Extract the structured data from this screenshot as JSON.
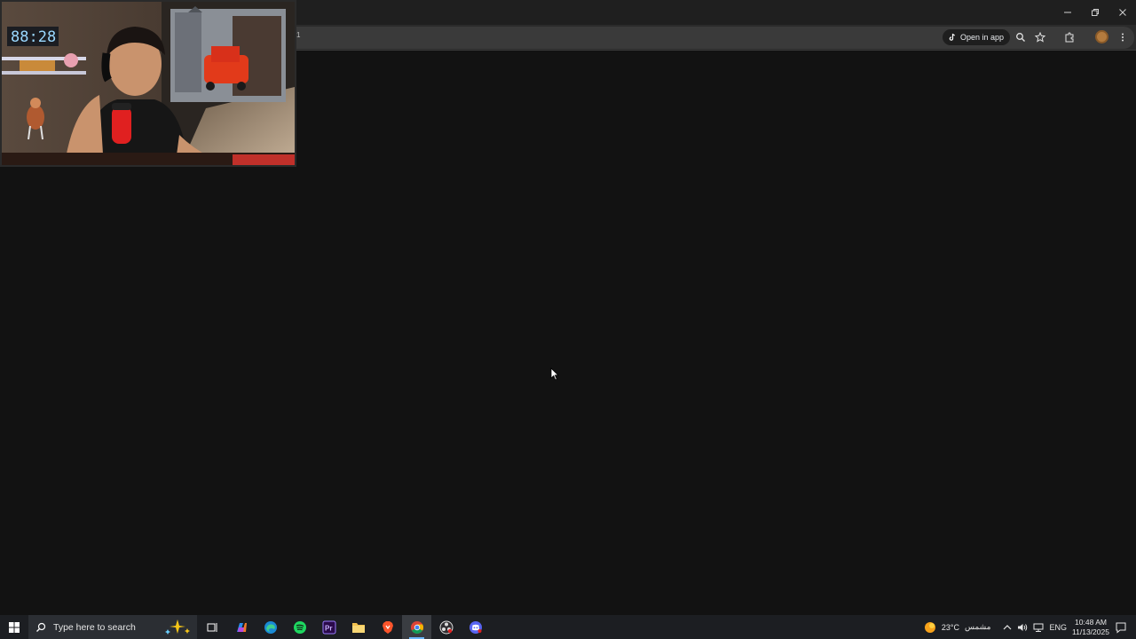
{
  "browser": {
    "url_fragment": "1",
    "open_in_app_label": "Open in app",
    "icons": {
      "app_logo": "tiktok-icon",
      "zoom": "zoom-icon",
      "bookmark": "star-icon",
      "extensions": "puzzle-icon",
      "profile": "avatar",
      "menu": "more-vert-icon"
    },
    "window_controls": [
      "minimize",
      "restore",
      "close"
    ]
  },
  "webcam": {
    "clock_display": "88:28"
  },
  "taskbar": {
    "search_placeholder": "Type here to search",
    "apps": [
      "task-view-icon",
      "copilot-icon",
      "edge-icon",
      "spotify-icon",
      "premiere-pro-icon",
      "file-explorer-icon",
      "brave-icon",
      "chrome-icon",
      "obs-icon",
      "discord-icon"
    ],
    "active_app": "chrome-icon",
    "premiere_label": "Pr"
  },
  "tray": {
    "weather_temp": "23°C",
    "weather_desc": "مشمس",
    "language": "ENG",
    "time": "10:48 AM",
    "date": "11/13/2025"
  },
  "colors": {
    "content_bg": "#121212",
    "toolbar_bg": "#2b2b2b",
    "taskbar_bg": "#1c1e22",
    "accent": "#6cb8ff"
  }
}
